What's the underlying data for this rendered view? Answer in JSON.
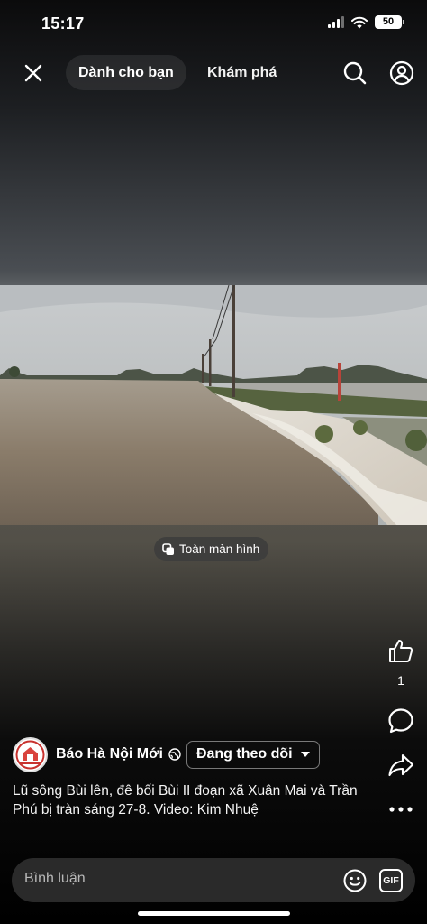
{
  "status_bar": {
    "time": "15:17",
    "battery": "50"
  },
  "nav": {
    "tab_for_you": "Dành cho bạn",
    "tab_explore": "Khám phá"
  },
  "video": {
    "fullscreen_label": "Toàn màn hình"
  },
  "actions": {
    "like_count": "1"
  },
  "post": {
    "author": "Báo Hà Nội Mới",
    "follow_label": "Đang theo dõi",
    "caption": "Lũ sông Bùi lên, đê bối Bùi II đoạn xã Xuân Mai và Trần Phú bị tràn sáng 27-8. Video: Kim Nhuệ"
  },
  "comment": {
    "placeholder": "Bình luận",
    "gif_label": "GIF"
  },
  "icons": [
    "signal-icon",
    "wifi-icon",
    "battery-icon",
    "close-icon",
    "search-icon",
    "profile-icon",
    "fullscreen-icon",
    "like-icon",
    "comment-icon",
    "share-icon",
    "more-icon",
    "globe-icon",
    "chevron-down-icon",
    "emoji-icon",
    "gif-icon"
  ]
}
